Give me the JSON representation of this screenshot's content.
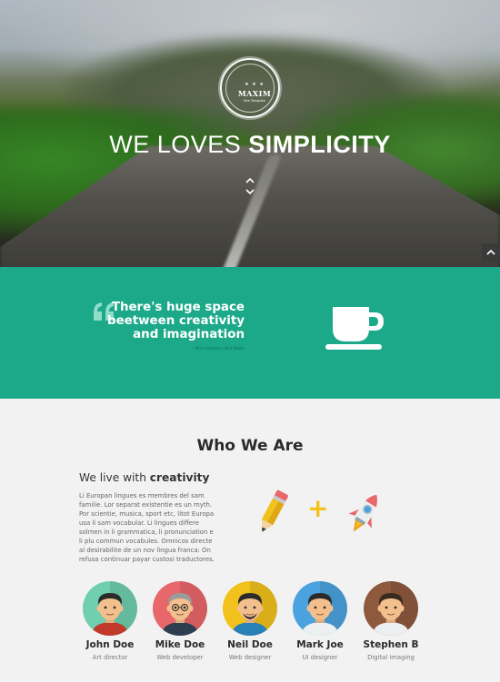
{
  "hero": {
    "logo_name": "MAXIM",
    "logo_stars": "★ ★ ★",
    "logo_sub": "Site Template",
    "title_light": "WE LOVES ",
    "title_bold": "SIMPLICITY"
  },
  "quote": {
    "text": "There's huge space beetween creativity and imagination",
    "author": "— Mark Simmons, Nett Media"
  },
  "about": {
    "title": "Who We Are",
    "subtitle_light": "We live with ",
    "subtitle_bold": "creativity",
    "body": "Li Europan lingues es membres del sam familie. Lor separat existentie es un myth. Por scientie, musica, sport etc, litot Europa usa li sam vocabular. Li lingues differe solmen in li grammatica, li pronunciation e li plu commun vocabules. Omnicos directe al desirabilite de un nov lingua franca: On refusa continuar payar custosi traductores.",
    "plus": "+"
  },
  "team": [
    {
      "name": "John Doe",
      "role": "Art director",
      "bg": "#6fcfae",
      "hair": "#2b2b2b",
      "shirt": "#c0392b",
      "skin": "#f3c08d",
      "glasses": false,
      "beard": false
    },
    {
      "name": "Mike Doe",
      "role": "Web developer",
      "bg": "#e8676b",
      "hair": "#9b9b9b",
      "shirt": "#2c3e50",
      "skin": "#f3c08d",
      "glasses": true,
      "beard": false
    },
    {
      "name": "Neil Doe",
      "role": "Web designer",
      "bg": "#f2c11c",
      "hair": "#2b2b2b",
      "shirt": "#2980b9",
      "skin": "#f3c08d",
      "glasses": false,
      "beard": true
    },
    {
      "name": "Mark Joe",
      "role": "UI designer",
      "bg": "#4aa3df",
      "hair": "#2b2b2b",
      "shirt": "#ecf0f1",
      "skin": "#f3c08d",
      "glasses": false,
      "beard": false
    },
    {
      "name": "Stephen B",
      "role": "Digital imaging",
      "bg": "#8e5a3e",
      "hair": "#3a2a20",
      "shirt": "#ecf0f1",
      "skin": "#f3c08d",
      "glasses": false,
      "beard": false
    }
  ],
  "colors": {
    "accent_green": "#1ba98a",
    "plus_yellow": "#f2c11c"
  },
  "icons": [
    "scroll-down-icon",
    "back-to-top-icon",
    "quote-icon",
    "coffee-cup-icon",
    "pencil-icon",
    "rocket-icon"
  ]
}
